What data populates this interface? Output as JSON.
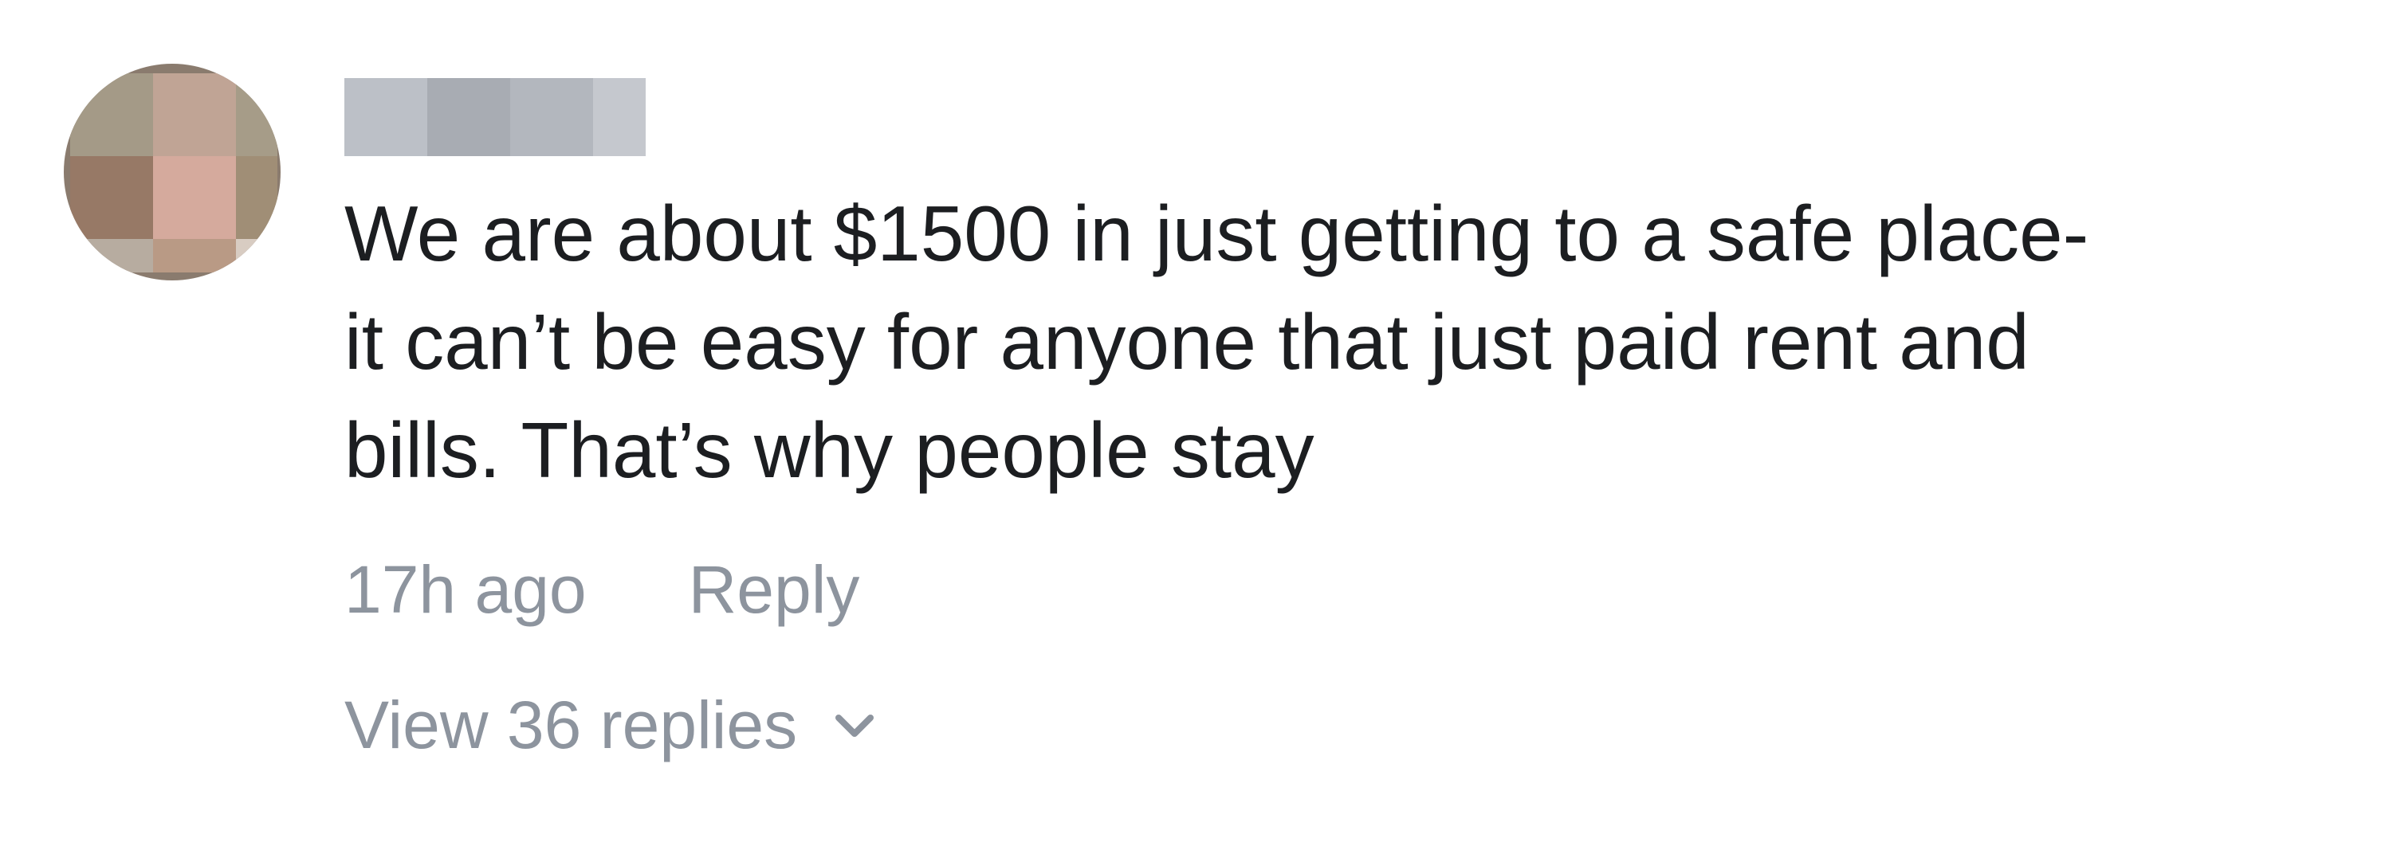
{
  "comment": {
    "author": "",
    "text": "We are about $1500 in just getting to a safe place-\nit can’t be easy for anyone that just paid rent and\nbills. That’s why people stay",
    "timestamp": "17h ago",
    "reply_label": "Reply",
    "view_replies_label": "View 36 replies",
    "view_replies_icon": "chevron-down-icon"
  },
  "colors": {
    "text": "#1c1e21",
    "meta": "#8d949e"
  }
}
